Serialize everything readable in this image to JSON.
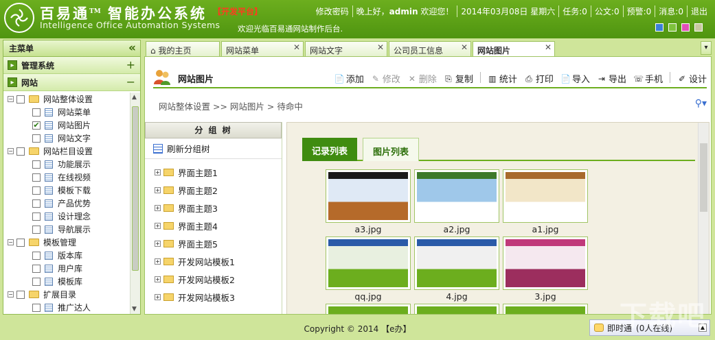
{
  "header": {
    "title": "百易通",
    "title_tm": "TM",
    "title_suffix": "智能办公系统",
    "subtitle": "Intelligence Office Automation Systems",
    "platform_tag": "【开发平台】",
    "marquee": "欢迎光临百易通网站制作后台.",
    "nav": {
      "change_password": "修改密码",
      "greeting_prefix": "晚上好，",
      "username": "admin",
      "greeting_suffix": " 欢迎您！",
      "date": "2014年03月08日 星期六",
      "tasks": "任务:0",
      "documents": "公文:0",
      "alerts": "预警:0",
      "messages": "消息:0",
      "logout": "退出"
    },
    "theme_colors": [
      "#3a7fd8",
      "#7ec23c",
      "#e04fb8",
      "#c8c8a0"
    ]
  },
  "sidebar": {
    "title": "主菜单",
    "groups": [
      {
        "label": "管理系统",
        "toggle": "+"
      },
      {
        "label": "网站",
        "toggle": "−"
      }
    ],
    "tree": [
      {
        "label": "网站整体设置",
        "level": 0,
        "type": "folder",
        "expand": "−",
        "checked": false
      },
      {
        "label": "网站菜单",
        "level": 1,
        "type": "doc",
        "checked": false
      },
      {
        "label": "网站图片",
        "level": 1,
        "type": "doc",
        "checked": true
      },
      {
        "label": "网站文字",
        "level": 1,
        "type": "doc",
        "checked": false
      },
      {
        "label": "网站栏目设置",
        "level": 0,
        "type": "folder",
        "expand": "−",
        "checked": false
      },
      {
        "label": "功能展示",
        "level": 1,
        "type": "doc",
        "checked": false
      },
      {
        "label": "在线视频",
        "level": 1,
        "type": "doc",
        "checked": false
      },
      {
        "label": "模板下载",
        "level": 1,
        "type": "doc",
        "checked": false
      },
      {
        "label": "产品优势",
        "level": 1,
        "type": "doc",
        "checked": false
      },
      {
        "label": "设计理念",
        "level": 1,
        "type": "doc",
        "checked": false
      },
      {
        "label": "导航展示",
        "level": 1,
        "type": "doc",
        "checked": false
      },
      {
        "label": "模板管理",
        "level": 0,
        "type": "folder",
        "expand": "−",
        "checked": false
      },
      {
        "label": "版本库",
        "level": 1,
        "type": "doc",
        "checked": false
      },
      {
        "label": "用户库",
        "level": 1,
        "type": "doc",
        "checked": false
      },
      {
        "label": "模板库",
        "level": 1,
        "type": "doc",
        "checked": false
      },
      {
        "label": "扩展目录",
        "level": 0,
        "type": "folder",
        "expand": "−",
        "checked": false
      },
      {
        "label": "推广达人",
        "level": 1,
        "type": "doc",
        "checked": false
      }
    ]
  },
  "tabs": [
    {
      "label": "我的主页",
      "closable": false,
      "active": false
    },
    {
      "label": "网站菜单",
      "closable": true,
      "active": false
    },
    {
      "label": "网站文字",
      "closable": true,
      "active": false
    },
    {
      "label": "公司员工信息",
      "closable": true,
      "active": false
    },
    {
      "label": "网站图片",
      "closable": true,
      "active": true
    }
  ],
  "page": {
    "title": "网站图片",
    "toolbar": [
      {
        "label": "添加",
        "icon": "add-icon",
        "glyph": "📄",
        "disabled": false
      },
      {
        "label": "修改",
        "icon": "edit-icon",
        "glyph": "✎",
        "disabled": true
      },
      {
        "label": "删除",
        "icon": "delete-icon",
        "glyph": "✕",
        "disabled": true
      },
      {
        "label": "复制",
        "icon": "copy-icon",
        "glyph": "⎘",
        "disabled": false
      },
      {
        "label": "统计",
        "icon": "chart-icon",
        "glyph": "▥",
        "disabled": false
      },
      {
        "label": "打印",
        "icon": "print-icon",
        "glyph": "⎙",
        "disabled": false
      },
      {
        "label": "导入",
        "icon": "import-icon",
        "glyph": "📄",
        "disabled": false
      },
      {
        "label": "导出",
        "icon": "export-icon",
        "glyph": "⇥",
        "disabled": false
      },
      {
        "label": "手机",
        "icon": "phone-icon",
        "glyph": "☏",
        "disabled": false
      },
      {
        "label": "设计",
        "icon": "design-icon",
        "glyph": "✐",
        "disabled": false
      }
    ],
    "breadcrumb": "网站整体设置 >> 网站图片 > 待命中"
  },
  "group_tree": {
    "title": "分 组 树",
    "refresh": "刷新分组树",
    "nodes": [
      "界面主题1",
      "界面主题2",
      "界面主题3",
      "界面主题4",
      "界面主题5",
      "开发网站模板1",
      "开发网站模板2",
      "开发网站模板3"
    ]
  },
  "gallery": {
    "tabs": [
      "记录列表",
      "图片列表"
    ],
    "images": [
      {
        "name": "a3.jpg",
        "palette": [
          "#1a1a1a",
          "#dfe9f5",
          "#b56a2a"
        ]
      },
      {
        "name": "a2.jpg",
        "palette": [
          "#3d7a2a",
          "#9fc8ea",
          "#ffffff"
        ]
      },
      {
        "name": "a1.jpg",
        "palette": [
          "#a86a2c",
          "#f2e6c8",
          "#ffffff"
        ]
      },
      {
        "name": "qq.jpg",
        "palette": [
          "#2a5aa8",
          "#e8f0e0",
          "#6cae1e"
        ]
      },
      {
        "name": "4.jpg",
        "palette": [
          "#2a5aa8",
          "#f0f0f0",
          "#6cae1e"
        ]
      },
      {
        "name": "3.jpg",
        "palette": [
          "#c0397a",
          "#f5e8ef",
          "#9c2e5e"
        ]
      }
    ]
  },
  "footer": {
    "copyright": "Copyright © 2014 【e办】",
    "im_label": "即时通",
    "im_status": "(0人在线)"
  },
  "watermark": "下载吧"
}
